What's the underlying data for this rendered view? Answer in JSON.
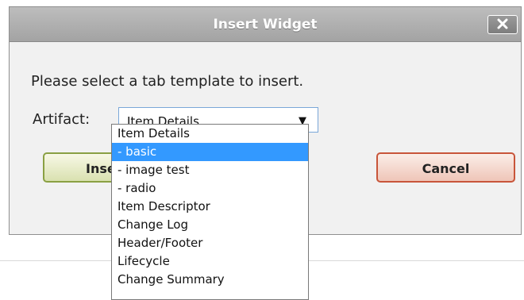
{
  "dialog": {
    "title": "Insert Widget",
    "close_icon": "close-x-icon",
    "prompt": "Please select a tab template to insert.",
    "artifact_label": "Artifact:",
    "select_value": "Item Details",
    "select_arrow": "▼",
    "insert_label": "Insert",
    "cancel_label": "Cancel"
  },
  "dropdown": {
    "options": [
      "Item Details",
      "- basic",
      "- image test",
      "- radio",
      "Item Descriptor",
      "Change Log",
      "Header/Footer",
      "Lifecycle",
      "Change Summary"
    ],
    "highlighted": "- basic"
  },
  "colors": {
    "highlight": "#3399ff",
    "titlebar": "#a8a8a8",
    "insert_border": "#8aa043",
    "cancel_border": "#c8553a"
  }
}
